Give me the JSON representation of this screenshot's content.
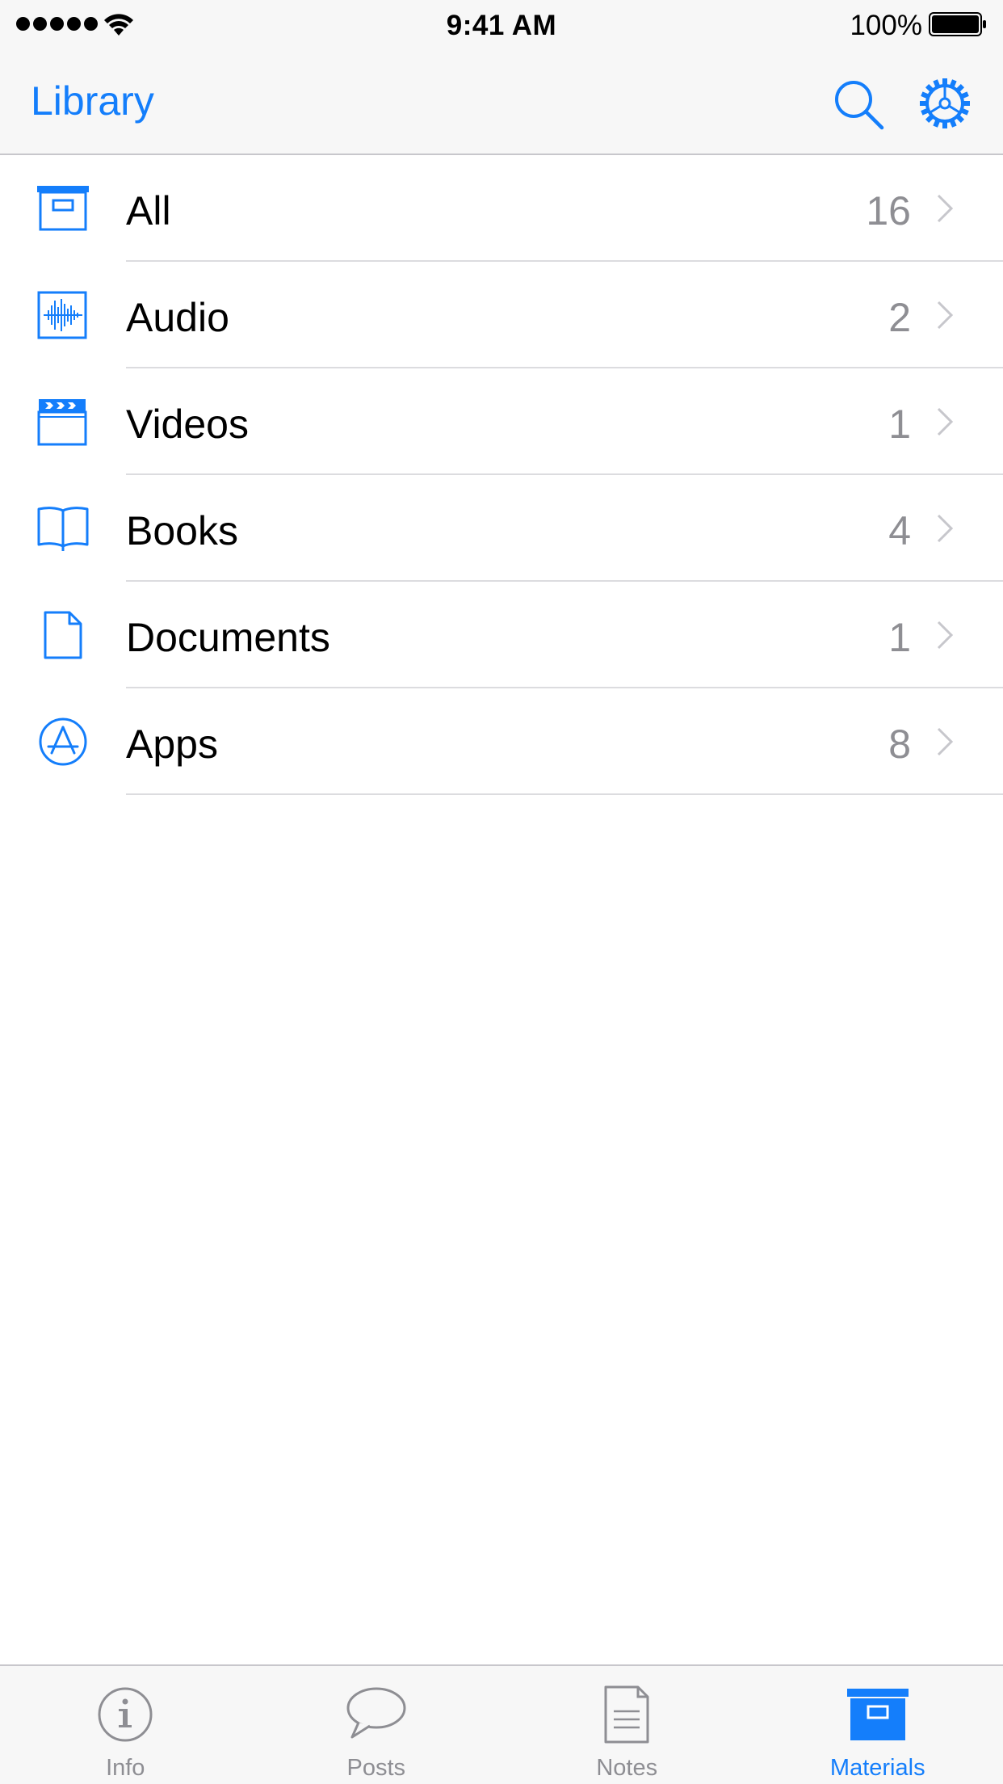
{
  "status_bar": {
    "time": "9:41 AM",
    "battery_percent": "100%",
    "signal_bars": 5,
    "battery_level": 1.0
  },
  "nav": {
    "title": "Library",
    "search_icon": "search-icon",
    "settings_icon": "gear-icon"
  },
  "list": {
    "items": [
      {
        "label": "All",
        "count": "16",
        "icon": "archive-box-icon"
      },
      {
        "label": "Audio",
        "count": "2",
        "icon": "waveform-icon"
      },
      {
        "label": "Videos",
        "count": "1",
        "icon": "clapperboard-icon"
      },
      {
        "label": "Books",
        "count": "4",
        "icon": "open-book-icon"
      },
      {
        "label": "Documents",
        "count": "1",
        "icon": "document-icon"
      },
      {
        "label": "Apps",
        "count": "8",
        "icon": "app-store-icon"
      }
    ]
  },
  "tabs": [
    {
      "label": "Info",
      "icon": "info-icon",
      "active": false
    },
    {
      "label": "Posts",
      "icon": "speech-bubble-icon",
      "active": false
    },
    {
      "label": "Notes",
      "icon": "note-page-icon",
      "active": false
    },
    {
      "label": "Materials",
      "icon": "archive-box-icon",
      "active": true
    }
  ],
  "colors": {
    "accent": "#147efb",
    "inactive_tab": "#8e8e93",
    "count_text": "#8e8e93",
    "chevron": "#c7c7cc",
    "separator": "#dcdcdf",
    "bar_background": "#f7f7f7"
  }
}
